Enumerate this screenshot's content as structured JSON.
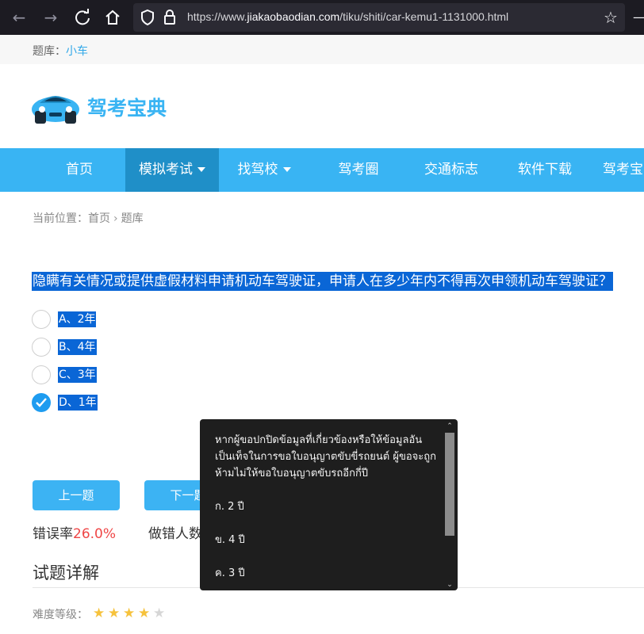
{
  "browser": {
    "url_prefix": "https://www.",
    "url_domain": "jiakaobaodian.com",
    "url_path": "/tiku/shiti/car-kemu1-1131000.html",
    "icons": [
      "back-icon",
      "forward-icon",
      "reload-icon",
      "home-icon",
      "shield-icon",
      "lock-icon",
      "star-icon",
      "menu-icon"
    ]
  },
  "topbar": {
    "label": "题库：",
    "link": "小车"
  },
  "logo": {
    "text": "驾考宝典",
    "accent": "#39b4f3"
  },
  "nav": {
    "items": [
      {
        "label": "首页"
      },
      {
        "label": "模拟考试"
      },
      {
        "label": "找驾校"
      },
      {
        "label": "驾考圈"
      },
      {
        "label": "交通标志"
      },
      {
        "label": "软件下载"
      },
      {
        "label": "驾考宝"
      }
    ]
  },
  "location": {
    "label": "当前位置：",
    "home": "首页",
    "current": "题库"
  },
  "question": {
    "text": "隐瞒有关情况或提供虚假材料申请机动车驾驶证，申请人在多少年内不得再次申领机动车驾驶证？",
    "options": [
      {
        "label": "A、2年",
        "checked": false
      },
      {
        "label": "B、4年",
        "checked": false
      },
      {
        "label": "C、3年",
        "checked": false
      },
      {
        "label": "D、1年",
        "checked": true
      }
    ]
  },
  "buttons": {
    "prev": "上一题",
    "next": "下一题"
  },
  "stats": {
    "error_rate_label": "错误率",
    "error_rate_value": "26.0%",
    "wrong_count_label": "做错人数"
  },
  "explanation": {
    "title": "试题详解",
    "difficulty_label": "难度等级：",
    "difficulty_stars": 4,
    "max_stars": 5
  },
  "translation_popup": {
    "paragraphs": [
      "หากผู้ขอปกปิดข้อมูลที่เกี่ยวข้องหรือให้ข้อมูลอันเป็นเท็จในการขอใบอนุญาตขับขี่รถยนต์ ผู้ขอจะถูกห้ามไม่ให้ขอใบอนุญาตขับรถอีกกี่ปี",
      "ก. 2 ปี",
      "ข. 4 ปี",
      "ค. 3 ปี"
    ]
  }
}
